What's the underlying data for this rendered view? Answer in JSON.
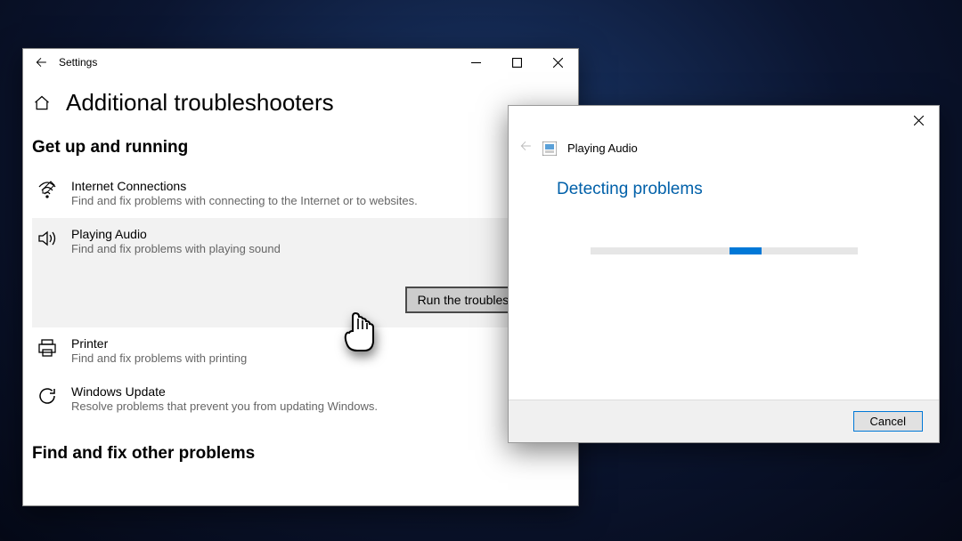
{
  "settings": {
    "titlebar": {
      "title": "Settings"
    },
    "page_title": "Additional troubleshooters",
    "section1_title": "Get up and running",
    "section2_title": "Find and fix other problems",
    "items": [
      {
        "label": "Internet Connections",
        "desc": "Find and fix problems with connecting to the Internet or to websites."
      },
      {
        "label": "Playing Audio",
        "desc": "Find and fix problems with playing sound"
      },
      {
        "label": "Printer",
        "desc": "Find and fix problems with printing"
      },
      {
        "label": "Windows Update",
        "desc": "Resolve problems that prevent you from updating Windows."
      }
    ],
    "run_button": "Run the troubleshooter"
  },
  "dialog": {
    "app_name": "Playing Audio",
    "status": "Detecting problems",
    "progress": {
      "left_pct": 52,
      "width_pct": 12
    },
    "cancel": "Cancel"
  }
}
